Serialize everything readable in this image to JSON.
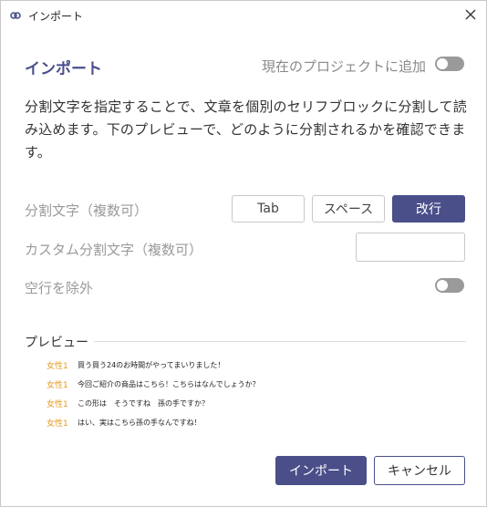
{
  "window": {
    "title": "インポート",
    "app_icon": "app-logo-icon",
    "close_icon": "close-icon"
  },
  "header": {
    "title": "インポート",
    "add_to_project_label": "現在のプロジェクトに追加",
    "add_to_project_enabled": false
  },
  "description": "分割文字を指定することで、文章を個別のセリフブロックに分割して読み込めます。下のプレビューで、どのように分割されるかを確認できます。",
  "split": {
    "label": "分割文字（複数可）",
    "options": [
      {
        "label": "Tab",
        "selected": false
      },
      {
        "label": "スペース",
        "selected": false
      },
      {
        "label": "改行",
        "selected": true
      }
    ]
  },
  "custom_split": {
    "label": "カスタム分割文字（複数可）",
    "value": ""
  },
  "exclude_blank": {
    "label": "空行を除外",
    "enabled": false
  },
  "preview": {
    "title": "プレビュー",
    "rows": [
      {
        "speaker": "女性1",
        "text": "買う買う24のお時間がやってまいりました！"
      },
      {
        "speaker": "女性1",
        "text": "今回ご紹介の商品はこちら！こちらはなんでしょうか？"
      },
      {
        "speaker": "女性1",
        "text": "この形は　そうですね　孫の手ですか？"
      },
      {
        "speaker": "女性1",
        "text": "はい、実はこちら孫の手なんですね！"
      }
    ]
  },
  "footer": {
    "import_label": "インポート",
    "cancel_label": "キャンセル"
  },
  "colors": {
    "accent": "#4a4f8a",
    "speaker": "#e69a1c",
    "toggle_off": "#9a9a9a"
  }
}
